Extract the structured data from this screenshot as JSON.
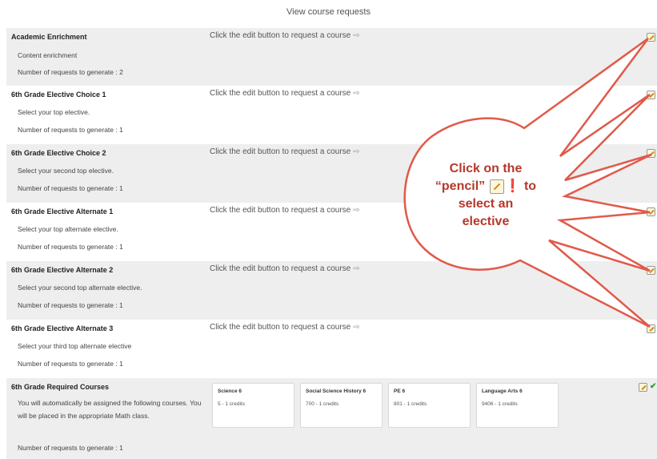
{
  "page": {
    "title": "View course requests"
  },
  "hint_text": "Click the edit button to request a course",
  "hint_arrow": "⇨",
  "count_prefix": "Number of requests to generate :",
  "sections": [
    {
      "title": "Academic Enrichment",
      "description": "Content enrichment",
      "count_text": "Number of requests to generate : 2"
    },
    {
      "title": "6th Grade Elective Choice 1",
      "description": "Select your top elective.",
      "count_text": "Number of requests to generate : 1"
    },
    {
      "title": "6th Grade Elective Choice 2",
      "description": "Select your second top elective.",
      "count_text": "Number of requests to generate : 1"
    },
    {
      "title": "6th Grade Elective Alternate 1",
      "description": "Select your top alternate elective.",
      "count_text": "Number of requests to generate : 1"
    },
    {
      "title": "6th Grade Elective Alternate 2",
      "description": "Select your second top alternate elective.",
      "count_text": "Number of requests to generate : 1"
    },
    {
      "title": "6th Grade Elective Alternate 3",
      "description": "Select your third top alternate elective",
      "count_text": "Number of requests to generate : 1"
    }
  ],
  "required": {
    "title": "6th Grade Required Courses",
    "description": "You will automatically be assigned the following courses. You will be placed in the appropriate Math class.",
    "count_text": "Number of requests to generate : 1",
    "courses": [
      {
        "name": "Science 6",
        "credits": "5 - 1 credits"
      },
      {
        "name": "Social Science History 6",
        "credits": "700 - 1 credits"
      },
      {
        "name": "PE 6",
        "credits": "801 - 1 credits"
      },
      {
        "name": "Language Arts 6",
        "credits": "9406 - 1 credits"
      }
    ]
  },
  "callout": {
    "line1": "Click on the",
    "line2_pre": "“pencil”",
    "line2_bang": "❗",
    "line2_post": "to",
    "line3": "select an",
    "line4": "elective"
  },
  "colors": {
    "callout_stroke": "#e05a4a",
    "callout_text": "#b5382a",
    "row_shade": "#eeeeee"
  }
}
